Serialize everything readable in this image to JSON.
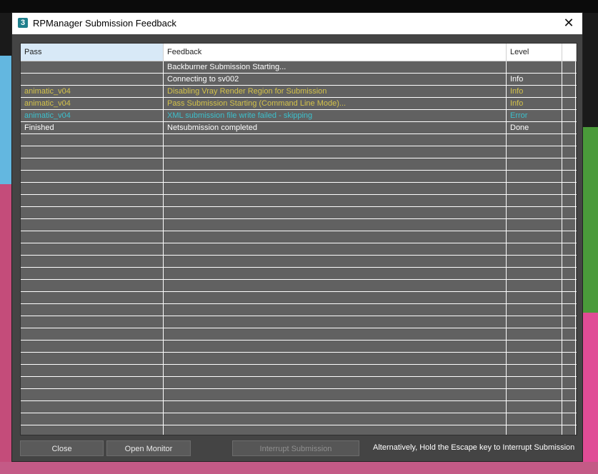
{
  "window": {
    "title": "RPManager Submission Feedback",
    "icon_label": "3",
    "close_glyph": "✕"
  },
  "table": {
    "columns": [
      "Pass",
      "Feedback",
      "Level",
      ""
    ],
    "rows": [
      {
        "pass": "",
        "feedback": "Backburner Submission Starting...",
        "level": "",
        "color": "white"
      },
      {
        "pass": "",
        "feedback": "Connecting to sv002",
        "level": "Info",
        "color": "white"
      },
      {
        "pass": "animatic_v04",
        "feedback": "Disabling Vray Render Region for Submission",
        "level": "Info",
        "color": "yellow"
      },
      {
        "pass": "animatic_v04",
        "feedback": "Pass Submission Starting (Command Line Mode)...",
        "level": "Info",
        "color": "yellow"
      },
      {
        "pass": "animatic_v04",
        "feedback": "XML submission file write failed - skipping",
        "level": "Error",
        "color": "cyan"
      },
      {
        "pass": "Finished",
        "feedback": "Netsubmission completed",
        "level": "Done",
        "color": "white"
      }
    ],
    "empty_row_count": 25
  },
  "buttons": {
    "close": "Close",
    "open_monitor": "Open Monitor",
    "interrupt": "Interrupt Submission"
  },
  "hint": "Alternatively, Hold the Escape key  to Interrupt Submission",
  "colors": {
    "text_white": "#ffffff",
    "text_yellow": "#d4c24a",
    "text_cyan": "#3cc0cc",
    "grid_bg": "#616161",
    "header_selected": "#d8e9f7"
  }
}
